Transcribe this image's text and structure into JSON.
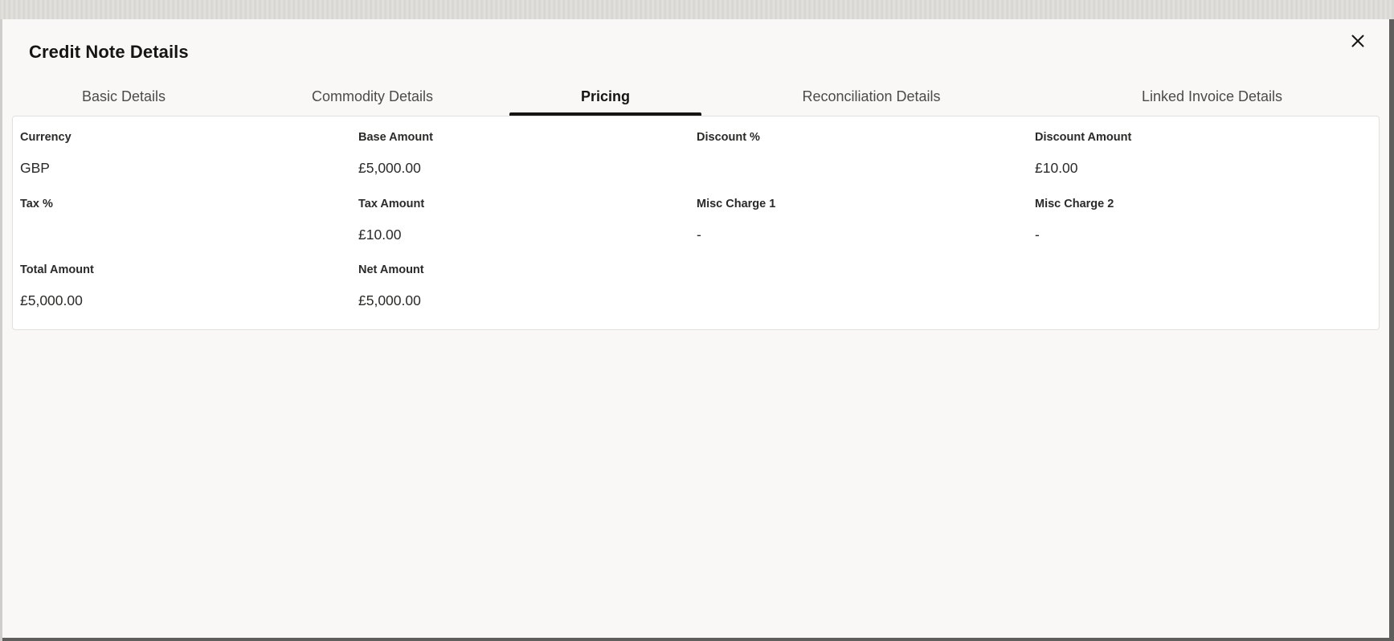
{
  "dialog": {
    "title": "Credit Note Details",
    "close_icon": "close-icon"
  },
  "tabs": [
    {
      "label": "Basic Details",
      "active": false
    },
    {
      "label": "Commodity Details",
      "active": false
    },
    {
      "label": "Pricing",
      "active": true
    },
    {
      "label": "Reconciliation Details",
      "active": false
    },
    {
      "label": "Linked Invoice Details",
      "active": false
    }
  ],
  "pricing": {
    "currency": {
      "label": "Currency",
      "value": "GBP"
    },
    "base_amount": {
      "label": "Base Amount",
      "value": "£5,000.00"
    },
    "discount_percent": {
      "label": "Discount %",
      "value": ""
    },
    "discount_amount": {
      "label": "Discount Amount",
      "value": "£10.00"
    },
    "tax_percent": {
      "label": "Tax %",
      "value": ""
    },
    "tax_amount": {
      "label": "Tax Amount",
      "value": "£10.00"
    },
    "misc_charge_1": {
      "label": "Misc Charge 1",
      "value": "-"
    },
    "misc_charge_2": {
      "label": "Misc Charge 2",
      "value": "-"
    },
    "total_amount": {
      "label": "Total Amount",
      "value": "£5,000.00"
    },
    "net_amount": {
      "label": "Net Amount",
      "value": "£5,000.00"
    }
  },
  "colors": {
    "dialog_background": "#f9f8f6",
    "text_primary": "#161513",
    "tab_inactive": "#4d4b48",
    "panel_border": "#e2e0dc"
  }
}
